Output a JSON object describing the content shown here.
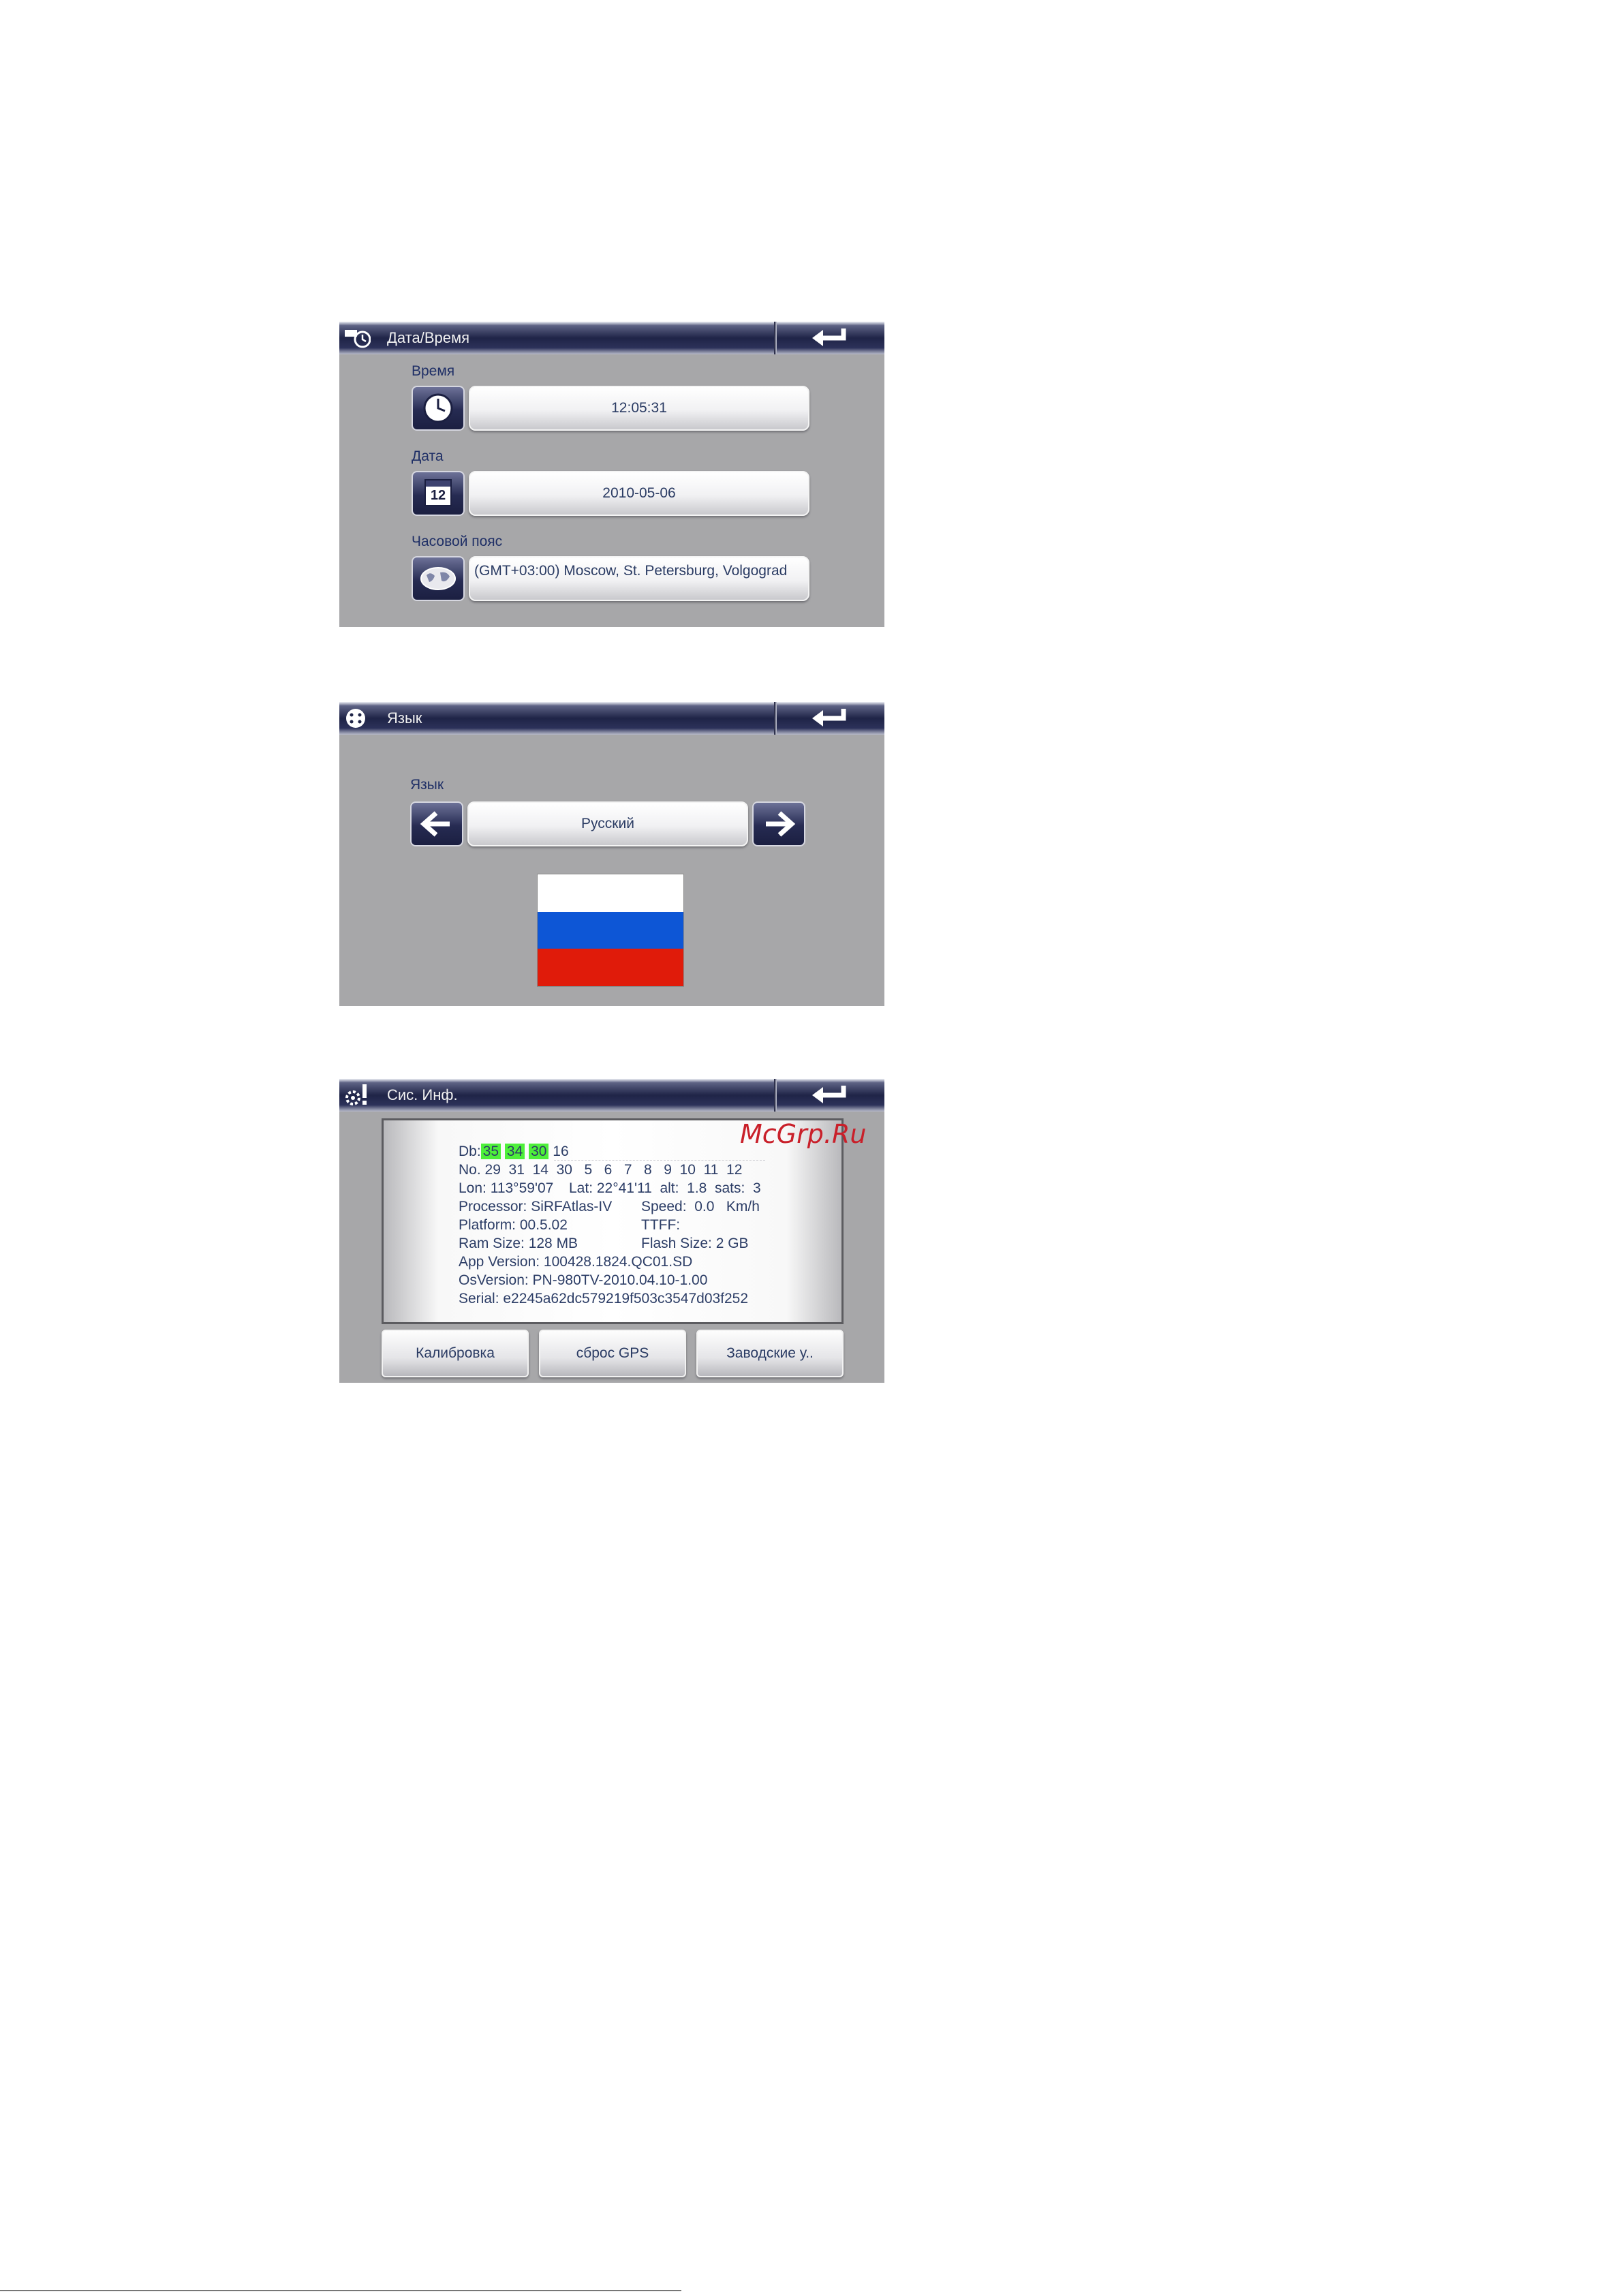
{
  "datetime_screen": {
    "title": "Дата/Время",
    "time_label": "Время",
    "time_value": "12:05:31",
    "date_label": "Дата",
    "date_value": "2010-05-06",
    "calendar_day": "12",
    "timezone_label": "Часовой пояс",
    "timezone_value": "(GMT+03:00) Moscow, St. Petersburg, Volgograd"
  },
  "language_screen": {
    "title": "Язык",
    "language_label": "Язык",
    "language_value": "Русский",
    "flag_colors": [
      "#ffffff",
      "#0d56d6",
      "#e01b0a"
    ]
  },
  "sysinfo_screen": {
    "title": "Сис. Инф.",
    "db_label": "Db:",
    "db_values": [
      "35",
      "34",
      "30",
      "16"
    ],
    "no_line": "No. 29  31  14  30   5   6   7   8   9  10  11  12",
    "lon": "Lon: 113°59'07",
    "lat_alt_sats": "Lat: 22°41'11  alt:  1.8  sats:  3",
    "processor": "Processor: SiRFAtlas-IV",
    "speed": "Speed:  0.0   Km/h",
    "platform": "Platform: 00.5.02",
    "ttff": "TTFF:",
    "ram": "Ram Size: 128 MB",
    "flash": "Flash Size: 2 GB",
    "app_version": "App Version: 100428.1824.QC01.SD",
    "os_version": "OsVersion: PN-980TV-2010.04.10-1.00",
    "serial": "Serial: e2245a62dc579219f503c3547d03f252",
    "buttons": [
      "Калибровка",
      "сброс GPS",
      "Заводские у.."
    ]
  },
  "watermark": "McGrp.Ru",
  "colors": {
    "title_bar": "#1f2447",
    "screen_bg": "#a7a7a9",
    "highlight": "#4ef03a",
    "text": "#2a3b63"
  }
}
